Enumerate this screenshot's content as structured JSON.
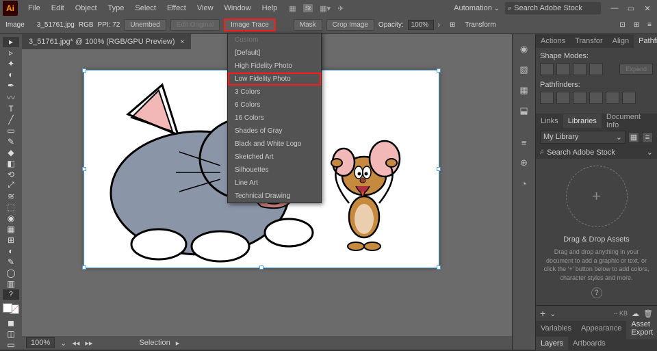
{
  "app_icon": "Ai",
  "menus": [
    "File",
    "Edit",
    "Object",
    "Type",
    "Select",
    "Effect",
    "View",
    "Window",
    "Help"
  ],
  "automation": "Automation",
  "search_placeholder": "Search Adobe Stock",
  "ctrl": {
    "image": "Image",
    "filename": "3_51761.jpg",
    "colormode": "RGB",
    "ppi": "PPI: 72",
    "unembed": "Unembed",
    "edit_original": "Edit Original",
    "image_trace": "Image Trace",
    "mask": "Mask",
    "crop": "Crop Image",
    "opacity_label": "Opacity:",
    "opacity": "100%",
    "transform": "Transform"
  },
  "doc_tab": "3_51761.jpg* @ 100% (RGB/GPU Preview)",
  "trace_presets": [
    "Custom",
    "[Default]",
    "High Fidelity Photo",
    "Low Fidelity Photo",
    "3 Colors",
    "6 Colors",
    "16 Colors",
    "Shades of Gray",
    "Black and White Logo",
    "Sketched Art",
    "Silhouettes",
    "Line Art",
    "Technical Drawing"
  ],
  "status": {
    "zoom": "100%",
    "mode": "Selection"
  },
  "panels": {
    "row1": [
      "Actions",
      "Transfor",
      "Align",
      "Pathfinder"
    ],
    "shape_modes": "Shape Modes:",
    "pathfinders": "Pathfinders:",
    "expand": "Expand",
    "row2": [
      "Links",
      "Libraries",
      "Document Info"
    ],
    "library": "My Library",
    "lib_search": "Search Adobe Stock",
    "drop_title": "Drag & Drop Assets",
    "drop_desc": "Drag and drop anything in your document to add a graphic or text, or click the '+' button below to add colors, character styles and more.",
    "kb": "-- KB",
    "row3": [
      "Variables",
      "Appearance",
      "Asset Export"
    ],
    "row4": [
      "Layers",
      "Artboards"
    ]
  }
}
